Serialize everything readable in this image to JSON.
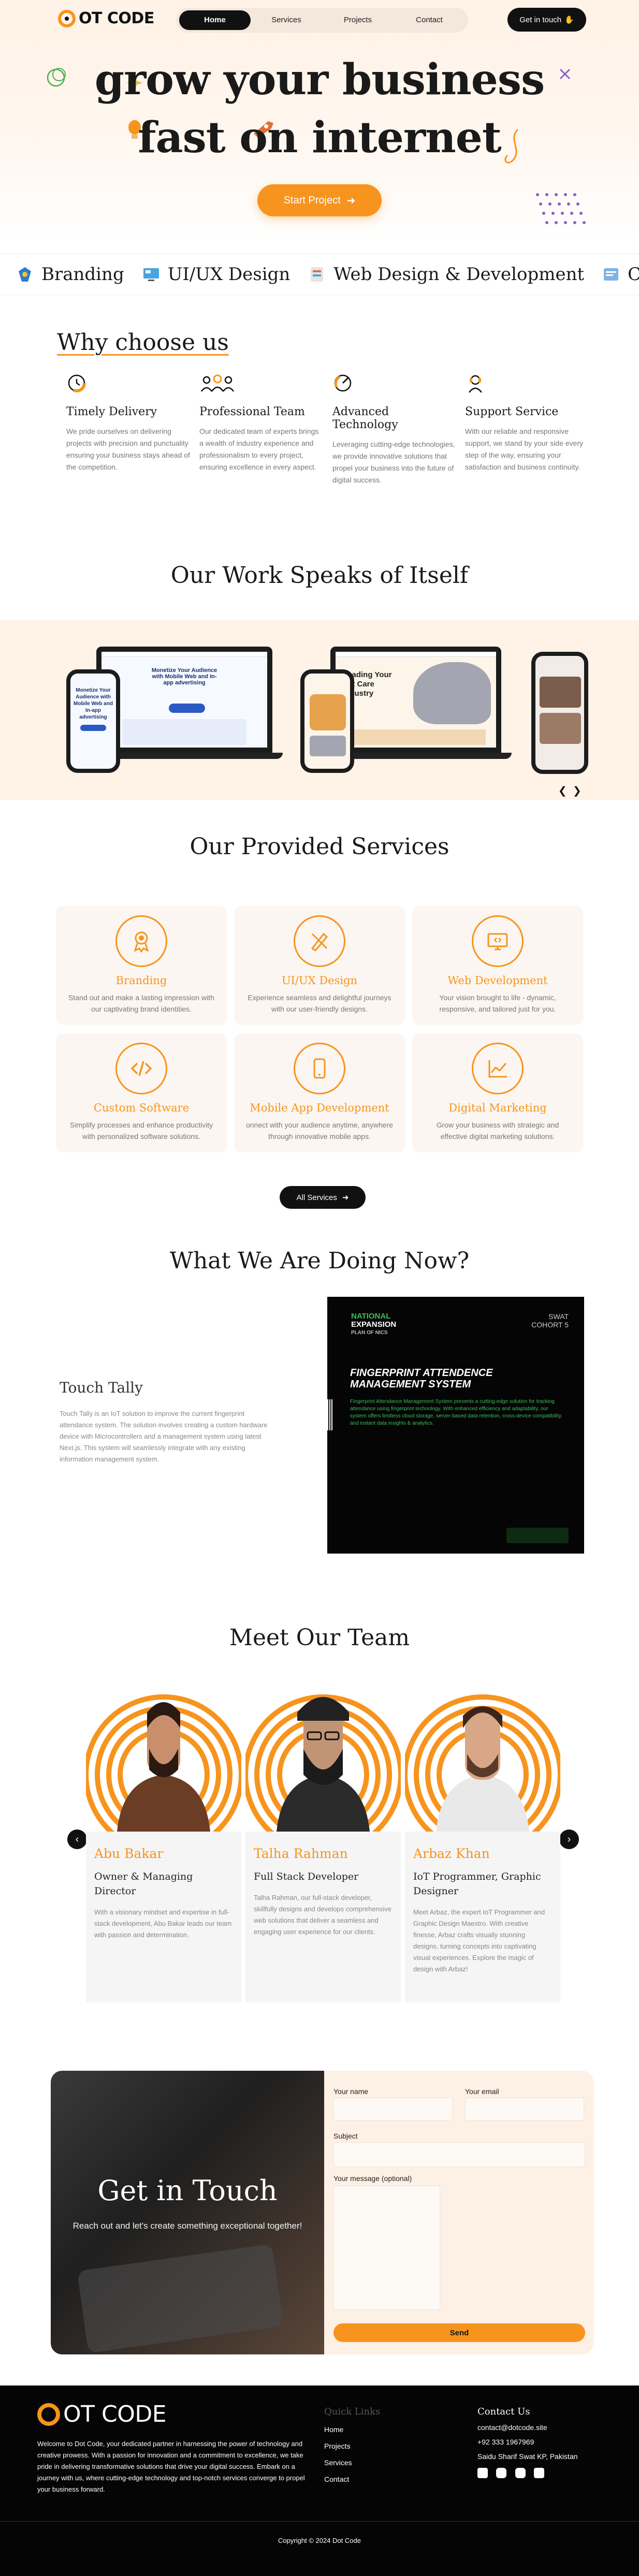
{
  "header": {
    "logo_text": "OT CODE",
    "nav": [
      "Home",
      "Services",
      "Projects",
      "Contact"
    ],
    "cta": "Get in touch"
  },
  "hero": {
    "line1": "grow your business",
    "line2": "fast on internet",
    "button": "Start Project"
  },
  "marquee": [
    "Branding",
    "UI/UX Design",
    "Web Design & Development",
    "Conten"
  ],
  "why": {
    "title": "Why choose us",
    "items": [
      {
        "title": "Timely Delivery",
        "icon": "clock-icon",
        "text": "We pride ourselves on delivering projects with precision and punctuality ensuring your business stays ahead of the competition."
      },
      {
        "title": "Professional Team",
        "icon": "team-icon",
        "text": "Our dedicated team of experts brings a wealth of industry experience and professionalism to every project, ensuring excellence in every aspect."
      },
      {
        "title": "Advanced Technology",
        "icon": "gauge-icon",
        "text": "Leveraging cutting-edge technologies, we provide innovative solutions that propel your business into the future of digital success."
      },
      {
        "title": "Support Service",
        "icon": "support-icon",
        "text": "With our reliable and responsive support, we stand by your side every step of the way, ensuring your satisfaction and business continuity."
      }
    ]
  },
  "work": {
    "title": "Our Work Speaks of Itself",
    "laptop1_headline": "Monetize Your Audience with Mobile Web and In-app advertising",
    "phone1_text": "Monetize Your Audience with Mobile Web and In-app advertising",
    "laptop2_headline": "Leading Your Pet Care Industry"
  },
  "services": {
    "title": "Our Provided Services",
    "items": [
      {
        "title": "Branding",
        "icon": "award-icon",
        "text": "Stand out and make a lasting impression with our captivating brand identities."
      },
      {
        "title": "UI/UX Design",
        "icon": "pen-ruler-icon",
        "text": "Experience seamless and delightful journeys with our user-friendly designs."
      },
      {
        "title": "Web Development",
        "icon": "monitor-icon",
        "text": "Your vision brought to life - dynamic, responsive, and tailored just for you."
      },
      {
        "title": "Custom Software",
        "icon": "code-icon",
        "text": "Simplify processes and enhance productivity with personalized software solutions."
      },
      {
        "title": "Mobile App Development",
        "icon": "phone-icon",
        "text": "onnect with your audience anytime, anywhere through innovative mobile apps."
      },
      {
        "title": "Digital Marketing",
        "icon": "chart-icon",
        "text": "Grow your business with strategic and effective digital marketing solutions."
      }
    ],
    "button": "All Services"
  },
  "doing": {
    "title": "What We Are Doing Now?",
    "project_title": "Touch Tally",
    "project_text": "Touch Tally is an IoT solution to improve the current fingerprint attendance system. The solution involves creating a custom hardware device with Microcontrollers and a management system using latest Next.js. This system will seamlessly integrate with any existing information management system.",
    "poster_badge1": "NATIONAL",
    "poster_badge2": "EXPANSION",
    "poster_badge3": "PLAN OF NICS",
    "poster_cohort1": "SWAT",
    "poster_cohort2": "COHORT 5",
    "poster_heading": "FINGERPRINT ATTENDENCE MANAGEMENT SYSTEM",
    "poster_body": "Fingerprint Attendance Management System presents a cutting-edge solution for tracking attendance using fingerprint technology. With enhanced efficiency and adaptability, our system offers limitless cloud storage, server-based data retention, cross-device compatibility, and instant data insights & analytics."
  },
  "team": {
    "title": "Meet Our Team",
    "members": [
      {
        "name": "Abu Bakar",
        "role": "Owner & Managing Director",
        "bio": "With a visionary mindset and expertise in full-stack development, Abu Bakar leads our team with passion and determination."
      },
      {
        "name": "Talha Rahman",
        "role": "Full Stack Developer",
        "bio": "Talha Rahman, our full-stack developer, skillfully designs and develops comprehensive web solutions that deliver a seamless and engaging user experience for our clients."
      },
      {
        "name": "Arbaz Khan",
        "role": "IoT Programmer, Graphic Designer",
        "bio": "Meet Arbaz, the expert IoT Programmer and Graphic Design Maestro. With creative finesse, Arbaz crafts visually stunning designs, turning concepts into captivating visual experiences. Explore the magic of design with Arbaz!"
      }
    ]
  },
  "contact": {
    "title": "Get in Touch",
    "subtitle": "Reach out and let's create something exceptional together!",
    "name_label": "Your name",
    "email_label": "Your email",
    "subject_label": "Subject",
    "message_label": "Your message (optional)",
    "send": "Send"
  },
  "footer": {
    "logo_text": "OT CODE",
    "about": "Welcome to Dot Code, your dedicated partner in harnessing the power of technology and creative prowess. With a passion for innovation and a commitment to excellence, we take pride in delivering transformative solutions that drive your digital success. Embark on a journey with us, where cutting-edge technology and top-notch services converge to propel your business forward.",
    "quick_title": "Quick Links",
    "links": [
      "Home",
      "Projects",
      "Services",
      "Contact"
    ],
    "contact_title": "Contact Us",
    "email": "contact@dotcode.site",
    "phone": "+92 333 1967969",
    "address": "Saidu Sharif Swat KP, Pakistan",
    "copyright": "Copyright © 2024 Dot Code"
  },
  "colors": {
    "accent": "#f7941d",
    "dark": "#111111",
    "cream": "#fff2e6"
  }
}
